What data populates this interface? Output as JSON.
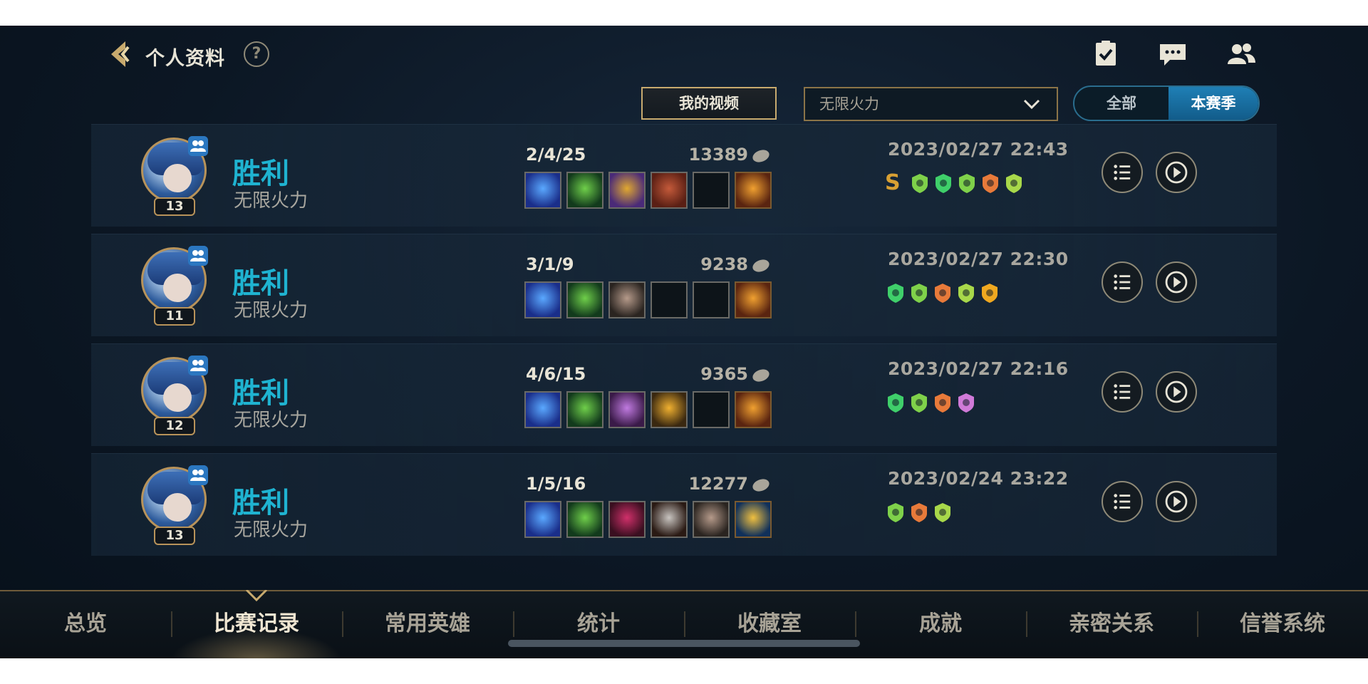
{
  "header": {
    "title": "个人资料",
    "help_glyph": "?"
  },
  "filters": {
    "video_button": "我的视频",
    "mode_selected": "无限火力",
    "toggle_all": "全部",
    "toggle_season": "本赛季",
    "toggle_active": "本赛季"
  },
  "matches": [
    {
      "result": "胜利",
      "mode": "无限火力",
      "level": "13",
      "kda": "2/4/25",
      "gold": "13389",
      "datetime": "2023/02/27 22:43",
      "grade": "S",
      "items": [
        "blue-rune-icon",
        "green-flower-icon",
        "gold-card-icon",
        "red-book-icon",
        "empty-slot",
        "gold-trinket-icon"
      ],
      "badges": [
        "flag-badge-icon",
        "heart-plus-badge-icon",
        "shield-badge-icon",
        "chain-badge-icon",
        "crown-badge-icon"
      ]
    },
    {
      "result": "胜利",
      "mode": "无限火力",
      "level": "11",
      "kda": "3/1/9",
      "gold": "9238",
      "datetime": "2023/02/27 22:30",
      "grade": "",
      "items": [
        "blue-rune-icon",
        "green-flower-icon",
        "stone-armor-icon",
        "empty-slot",
        "empty-slot",
        "gold-trinket-icon"
      ],
      "badges": [
        "heart-plus-badge-icon",
        "shield-badge-icon",
        "chain-badge-icon",
        "crown-badge-icon",
        "flame-badge-icon"
      ]
    },
    {
      "result": "胜利",
      "mode": "无限火力",
      "level": "12",
      "kda": "4/6/15",
      "gold": "9365",
      "datetime": "2023/02/27 22:16",
      "grade": "",
      "items": [
        "blue-rune-icon",
        "green-flower-icon",
        "purple-orb-icon",
        "gold-mace-icon",
        "empty-slot",
        "gold-trinket-icon"
      ],
      "badges": [
        "heart-plus-badge-icon",
        "shield-badge-icon",
        "chain-badge-icon",
        "wings-badge-icon"
      ]
    },
    {
      "result": "胜利",
      "mode": "无限火力",
      "level": "13",
      "kda": "1/5/16",
      "gold": "12277",
      "datetime": "2023/02/24 23:22",
      "grade": "",
      "items": [
        "blue-rune-icon",
        "green-flower-icon",
        "dark-hat-icon",
        "steel-armor-icon",
        "stone-armor-icon",
        "blue-lantern-trinket-icon"
      ],
      "badges": [
        "shield-badge-icon",
        "chain-badge-icon",
        "crown-badge-icon"
      ]
    }
  ],
  "bottom_nav": {
    "items": [
      "总览",
      "比赛记录",
      "常用英雄",
      "统计",
      "收藏室",
      "成就",
      "亲密关系",
      "信誉系统"
    ],
    "active": "比赛记录"
  },
  "colors": {
    "victory": "#1fb3d1",
    "gold_border": "#c8aa6e",
    "toggle_active": "#1f7fb5"
  }
}
